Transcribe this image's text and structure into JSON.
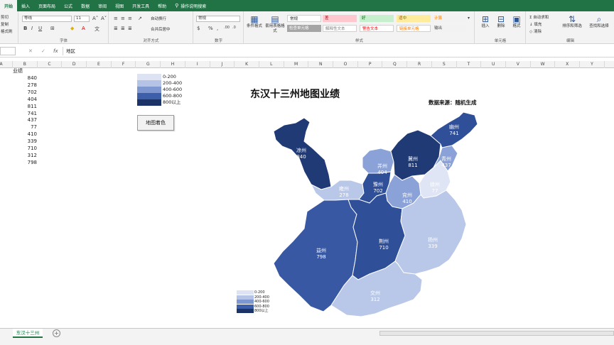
{
  "tabs": [
    "开始",
    "插入",
    "页面布局",
    "公式",
    "数据",
    "审阅",
    "视图",
    "开发工具",
    "帮助",
    "操作说明搜索"
  ],
  "ribbon": {
    "clipboard": {
      "cut": "剪切",
      "copy": "复制",
      "format_painter": "格式刷"
    },
    "font": {
      "name": "等线",
      "size": "11",
      "label": "字体"
    },
    "alignment": {
      "wrap": "自动换行",
      "merge": "合并后居中",
      "label": "对齐方式"
    },
    "number": {
      "format": "常规",
      "label": "数字"
    },
    "styles": {
      "conditional": "条件格式",
      "table_format": "套用表格格式",
      "label": "样式",
      "cells": [
        {
          "text": "常规",
          "bg": "#ffffff",
          "fg": "#222222"
        },
        {
          "text": "差",
          "bg": "#ffc7ce",
          "fg": "#9c0006"
        },
        {
          "text": "好",
          "bg": "#c6efce",
          "fg": "#006100"
        },
        {
          "text": "适中",
          "bg": "#ffeb9c",
          "fg": "#9c5700"
        },
        {
          "text": "计算",
          "bg": "#f2f2f2",
          "fg": "#fa7d00"
        },
        {
          "text": "检查单元格",
          "bg": "#a5a5a5",
          "fg": "#ffffff"
        },
        {
          "text": "解释性文本",
          "bg": "#ffffff",
          "fg": "#7f7f7f"
        },
        {
          "text": "警告文本",
          "bg": "#ffffff",
          "fg": "#ff0000"
        },
        {
          "text": "链接单元格",
          "bg": "#ffffff",
          "fg": "#fa7d00"
        },
        {
          "text": "输出",
          "bg": "#f2f2f2",
          "fg": "#3f3f3f"
        }
      ]
    },
    "cells_group": {
      "insert": "插入",
      "delete": "删除",
      "format": "格式",
      "label": "单元格"
    },
    "editing": {
      "autosum": "自动求和",
      "fill": "填充",
      "clear": "清除",
      "sort": "排序和筛选",
      "find": "查找和选择",
      "label": "编辑"
    }
  },
  "formula_bar": {
    "fx": "fx",
    "content": "地区"
  },
  "columns": [
    "A",
    "B",
    "C",
    "D",
    "E",
    "F",
    "G",
    "H",
    "I",
    "J",
    "K",
    "L",
    "M",
    "N",
    "O",
    "P",
    "Q",
    "R",
    "S",
    "T",
    "U",
    "V",
    "W",
    "X",
    "Y"
  ],
  "sheet": {
    "header": "业绩",
    "values": [
      "840",
      "278",
      "702",
      "404",
      "811",
      "741",
      "437",
      "77",
      "410",
      "339",
      "710",
      "312",
      "798"
    ]
  },
  "legend": [
    {
      "label": "0-200",
      "color": "#dde3f3"
    },
    {
      "label": "200-400",
      "color": "#b5c3e6"
    },
    {
      "label": "400-600",
      "color": "#7f97d0"
    },
    {
      "label": "600-800",
      "color": "#3d5ea9"
    },
    {
      "label": "800以上",
      "color": "#1c3368"
    }
  ],
  "map_button": "地图着色",
  "map_title": "东汉十三州地图业绩",
  "map_source": "数据来源：随机生成",
  "regions": [
    {
      "name": "凉州",
      "value": "840",
      "color": "#1f3a75"
    },
    {
      "name": "雍州",
      "value": "278",
      "color": "#b9c7e8"
    },
    {
      "name": "并州",
      "value": "404",
      "color": "#8aa2d7"
    },
    {
      "name": "冀州",
      "value": "811",
      "color": "#1f3a75"
    },
    {
      "name": "幽州",
      "value": "741",
      "color": "#2f4f98"
    },
    {
      "name": "豫州",
      "value": "702",
      "color": "#2f4f98"
    },
    {
      "name": "兖州",
      "value": "410",
      "color": "#8aa2d7"
    },
    {
      "name": "徐州",
      "value": "77",
      "color": "#dfe5f4"
    },
    {
      "name": "青州",
      "value": "437",
      "color": "#8aa2d7"
    },
    {
      "name": "益州",
      "value": "798",
      "color": "#3858a3"
    },
    {
      "name": "荆州",
      "value": "710",
      "color": "#2f4f98"
    },
    {
      "name": "扬州",
      "value": "339",
      "color": "#b9c7e8"
    },
    {
      "name": "交州",
      "value": "312",
      "color": "#b9c7e8"
    }
  ],
  "sheet_tab": "东汉十三州"
}
